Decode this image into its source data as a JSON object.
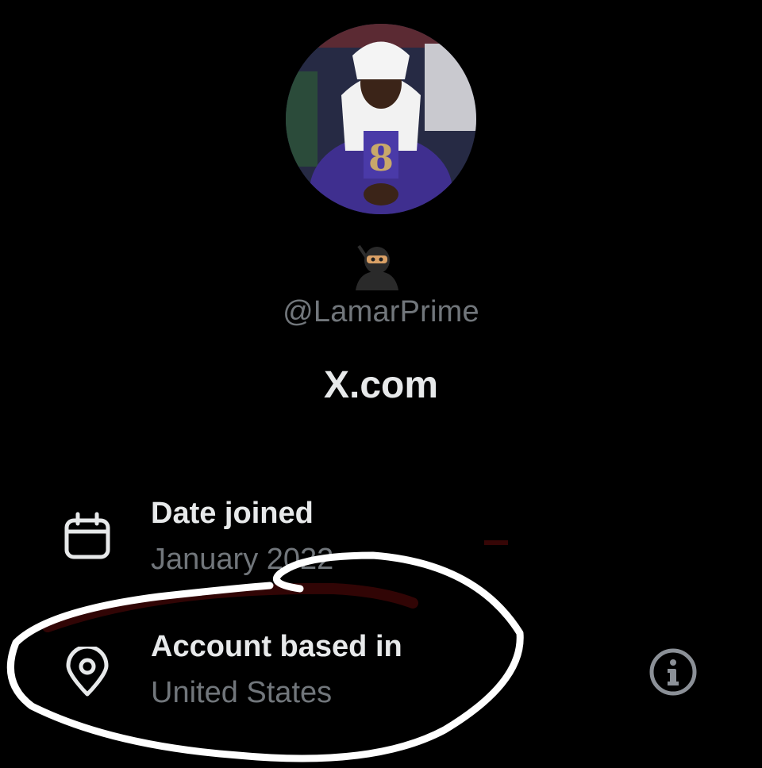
{
  "profile": {
    "emoji": "🥷",
    "handle": "@LamarPrime",
    "site": "X.com"
  },
  "about": {
    "date_joined": {
      "title": "Date joined",
      "value": "January 2022",
      "icon": "calendar-icon"
    },
    "account_based_in": {
      "title": "Account based in",
      "value": "United States",
      "icon": "location-pin-icon",
      "info_icon": "info-icon"
    }
  },
  "colors": {
    "background": "#000000",
    "primary_text": "#e7e9ea",
    "secondary_text": "#71767b",
    "annotation": "#ffffff"
  }
}
